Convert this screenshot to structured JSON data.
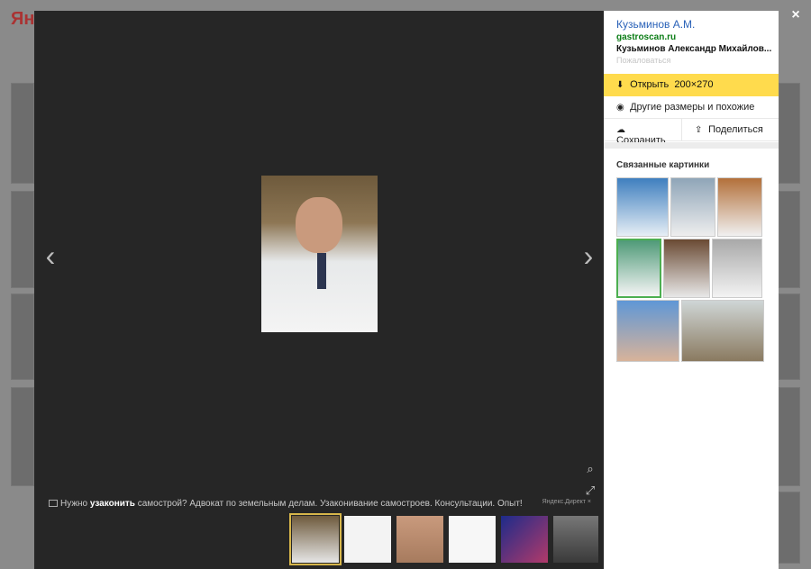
{
  "viewer": {
    "ad": {
      "text_before": "Нужно ",
      "text_bold": "узаконить",
      "text_after": " самострой? Адвокат по земельным делам. Узаконивание самостроев. Консультации. Опыт!",
      "source": "Яндекс.Директ"
    },
    "nav_prev": "‹",
    "nav_next": "›"
  },
  "panel": {
    "author": "Кузьминов А.М.",
    "site": "gastroscan.ru",
    "description": "Кузьминов Александр Михайлов...",
    "complain": "Пожаловаться",
    "open_label": "Открыть",
    "open_size": "200×270",
    "other_sizes": "Другие размеры и похожие",
    "save": "Сохранить",
    "share": "Поделиться",
    "related_title": "Связанные картинки"
  },
  "close": "×",
  "colors": {
    "accent": "#ffdb4d",
    "link": "#2a62b8",
    "site": "#0b7d16"
  }
}
